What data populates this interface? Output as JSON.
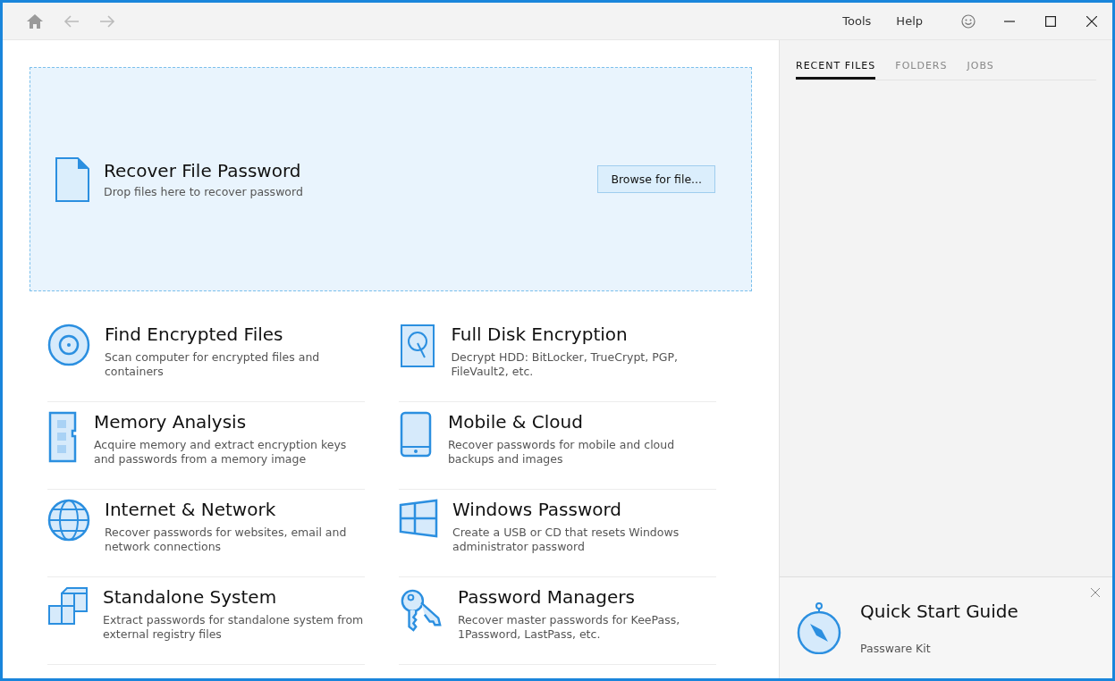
{
  "toolbar": {
    "menus": [
      "Tools",
      "Help"
    ]
  },
  "drop_zone": {
    "title": "Recover File Password",
    "subtitle": "Drop files here to recover password",
    "button": "Browse for file..."
  },
  "tools": [
    {
      "kind": "disc",
      "title": "Find Encrypted Files",
      "description": "Scan computer for encrypted files and containers"
    },
    {
      "kind": "disk",
      "title": "Full Disk Encryption",
      "description": "Decrypt HDD: BitLocker, TrueCrypt, PGP, FileVault2, etc."
    },
    {
      "kind": "memory",
      "title": "Memory Analysis",
      "description": "Acquire memory and extract encryption keys and passwords from a memory image"
    },
    {
      "kind": "phone",
      "title": "Mobile & Cloud",
      "description": "Recover passwords for mobile and cloud backups and images"
    },
    {
      "kind": "globe",
      "title": "Internet & Network",
      "description": "Recover passwords for websites, email and network connections"
    },
    {
      "kind": "windows",
      "title": "Windows Password",
      "description": "Create a USB or CD that resets Windows administrator password"
    },
    {
      "kind": "cubes",
      "title": "Standalone System",
      "description": "Extract passwords for standalone system from external registry files"
    },
    {
      "kind": "keys",
      "title": "Password Managers",
      "description": "Recover master passwords for KeePass, 1Password, LastPass, etc."
    }
  ],
  "side_tabs": [
    {
      "label": "RECENT FILES",
      "selected": true
    },
    {
      "label": "FOLDERS",
      "selected": false
    },
    {
      "label": "JOBS",
      "selected": false
    }
  ],
  "quick_start": {
    "title": "Quick Start Guide",
    "description": "Passware Kit"
  }
}
